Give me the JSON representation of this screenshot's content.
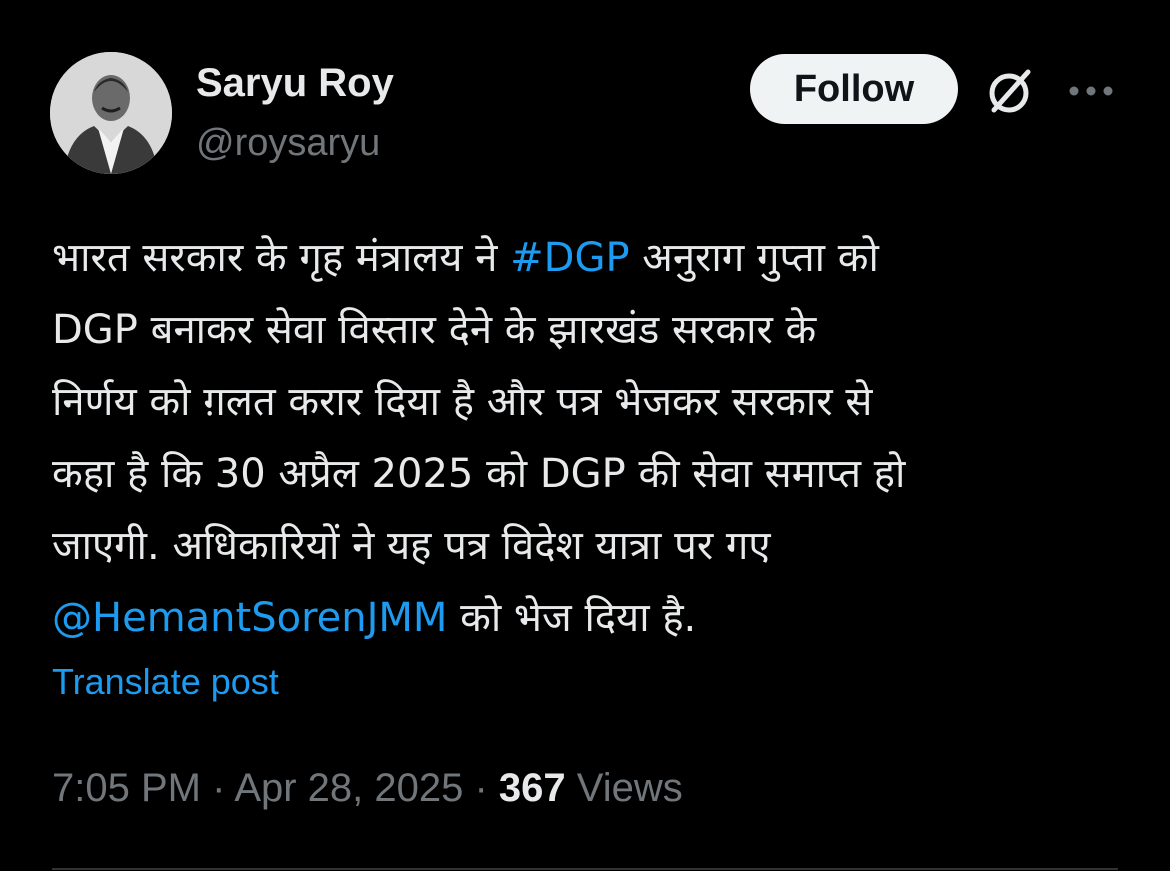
{
  "author": {
    "name": "Saryu Roy",
    "handle": "@roysaryu"
  },
  "actions": {
    "follow_label": "Follow"
  },
  "icons": {
    "grok": "grok-icon",
    "more": "more-icon"
  },
  "tweet": {
    "line1_a": "भारत सरकार के गृह मंत्रालय ने ",
    "hashtag": "#DGP",
    "line1_b": " अनुराग गुप्ता को",
    "line2": "DGP बनाकर सेवा विस्तार देने के झारखंड सरकार के",
    "line3": "निर्णय को ग़लत करार दिया है और पत्र भेजकर सरकार से",
    "line4": "कहा है कि 30 अप्रैल 2025 को DGP की सेवा समाप्त हो",
    "line5": "जाएगी. अधिकारियों ने यह पत्र विदेश यात्रा पर गए",
    "mention": "@HemantSorenJMM",
    "line6_b": " को भेज दिया है."
  },
  "translate_label": "Translate post",
  "meta": {
    "time": "7:05 PM",
    "separator": " · ",
    "date": "Apr 28, 2025",
    "views_count": "367",
    "views_label": " Views"
  },
  "colors": {
    "background": "#000000",
    "text": "#e7e9ea",
    "secondary": "#71767b",
    "link": "#1d9bf0",
    "follow_bg": "#eff3f4"
  }
}
